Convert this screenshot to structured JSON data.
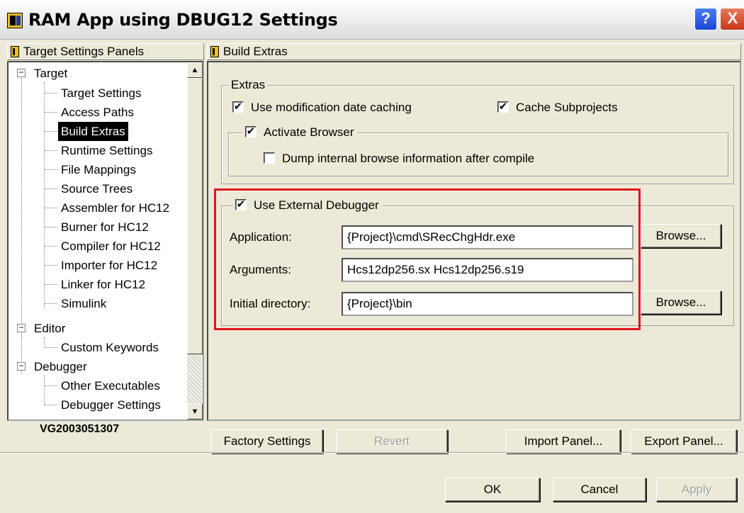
{
  "window": {
    "title": "RAM App using DBUG12 Settings",
    "help_glyph": "?",
    "close_glyph": "X"
  },
  "left_panel": {
    "header": "Target Settings Panels",
    "tree": [
      {
        "label": "Target",
        "level": 0,
        "expander": "−"
      },
      {
        "label": "Target Settings",
        "level": 1
      },
      {
        "label": "Access Paths",
        "level": 1
      },
      {
        "label": "Build Extras",
        "level": 1,
        "selected": true
      },
      {
        "label": "Runtime Settings",
        "level": 1
      },
      {
        "label": "File Mappings",
        "level": 1
      },
      {
        "label": "Source Trees",
        "level": 1
      },
      {
        "label": "Assembler for HC12",
        "level": 1
      },
      {
        "label": "Burner for HC12",
        "level": 1
      },
      {
        "label": "Compiler for HC12",
        "level": 1
      },
      {
        "label": "Importer for HC12",
        "level": 1
      },
      {
        "label": "Linker for HC12",
        "level": 1
      },
      {
        "label": "Simulink",
        "level": 1
      },
      {
        "label": "Editor",
        "level": 0,
        "expander": "−"
      },
      {
        "label": "Custom Keywords",
        "level": 1
      },
      {
        "label": "Debugger",
        "level": 0,
        "expander": "−"
      },
      {
        "label": "Other Executables",
        "level": 1
      },
      {
        "label": "Debugger Settings",
        "level": 1
      }
    ],
    "scroll_up_glyph": "▲",
    "scroll_down_glyph": "▼",
    "version": "VG2003051307"
  },
  "right_panel": {
    "header": "Build Extras",
    "extras_group": {
      "legend": "Extras",
      "use_mod_date_caching": {
        "label": "Use modification date caching",
        "checked": true
      },
      "cache_subprojects": {
        "label": "Cache Subprojects",
        "checked": true
      },
      "activate_browser": {
        "label": "Activate Browser",
        "checked": true
      },
      "dump_browse_info": {
        "label": "Dump internal browse information after compile",
        "checked": false
      }
    },
    "external_debugger": {
      "legend": "Use External Debugger",
      "checked": true,
      "application_label": "Application:",
      "application_value": "{Project}\\cmd\\SRecChgHdr.exe",
      "arguments_label": "Arguments:",
      "arguments_value": "Hcs12dp256.sx Hcs12dp256.s19",
      "initial_dir_label": "Initial directory:",
      "initial_dir_value": "{Project}\\bin",
      "browse_label": "Browse..."
    },
    "check_glyph": "✔"
  },
  "panel_buttons": {
    "factory_settings": "Factory Settings",
    "revert": "Revert",
    "import_panel": "Import Panel...",
    "export_panel": "Export Panel..."
  },
  "dialog_buttons": {
    "ok": "OK",
    "cancel": "Cancel",
    "apply": "Apply"
  },
  "colors": {
    "dialog_bg": "#ece9d8",
    "highlight_box": "#e0141e",
    "selection_bg": "#000000"
  }
}
